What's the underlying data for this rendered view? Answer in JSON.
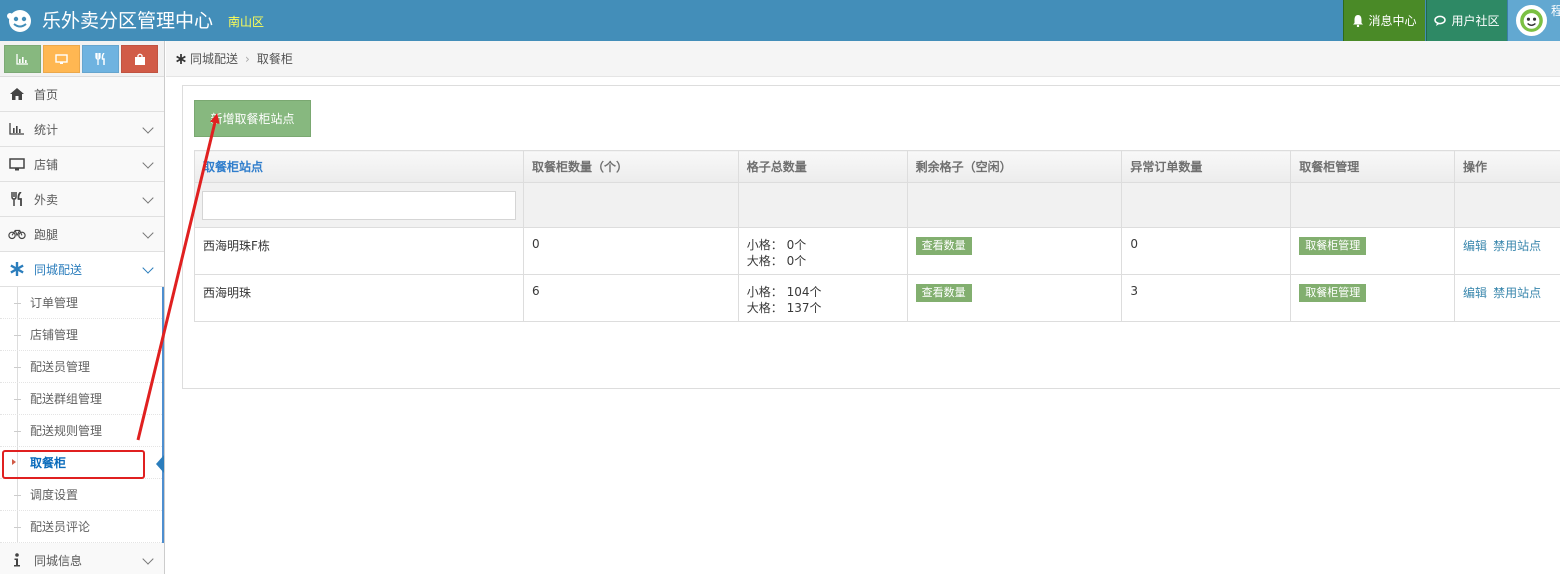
{
  "header": {
    "app_title": "乐外卖分区管理中心",
    "district": "南山区",
    "messages_label": "消息中心",
    "community_label": "用户社区",
    "user_name_partial": "程"
  },
  "colors": {
    "topbar": "#438eb9",
    "messages_bg": "#4a8a27",
    "community_bg": "#2e8965",
    "accent_green": "#87b87f",
    "link_blue": "#3a87ad",
    "annotation_red": "#e02020"
  },
  "shortcuts": [
    {
      "icon": "bar-chart-icon"
    },
    {
      "icon": "desktop-icon"
    },
    {
      "icon": "cutlery-icon"
    },
    {
      "icon": "shopping-bag-icon"
    }
  ],
  "sidebar": {
    "items": [
      {
        "label": "首页",
        "icon": "home-icon"
      },
      {
        "label": "统计",
        "icon": "bar-chart-icon"
      },
      {
        "label": "店铺",
        "icon": "desktop-icon"
      },
      {
        "label": "外卖",
        "icon": "cutlery-icon"
      },
      {
        "label": "跑腿",
        "icon": "bicycle-icon"
      },
      {
        "label": "同城配送",
        "icon": "asterisk-icon"
      },
      {
        "label": "同城信息",
        "icon": "info-icon"
      }
    ],
    "subitems": [
      {
        "label": "订单管理"
      },
      {
        "label": "店铺管理"
      },
      {
        "label": "配送员管理"
      },
      {
        "label": "配送群组管理"
      },
      {
        "label": "配送规则管理"
      },
      {
        "label": "取餐柜"
      },
      {
        "label": "调度设置"
      },
      {
        "label": "配送员评论"
      }
    ]
  },
  "breadcrumb": {
    "parent": "同城配送",
    "current": "取餐柜"
  },
  "main": {
    "add_button": "新增取餐柜站点",
    "columns": [
      "取餐柜站点",
      "取餐柜数量（个）",
      "格子总数量",
      "剩余格子（空闲）",
      "异常订单数量",
      "取餐柜管理",
      "操作"
    ],
    "rows": [
      {
        "site": "西海明珠F栋",
        "count": "0",
        "small": "小格：  0个",
        "large": "大格：  0个",
        "remaining": "查看数量",
        "abnormal": "0",
        "manage": "取餐柜管理",
        "edit": "编辑",
        "disable": "禁用站点"
      },
      {
        "site": "西海明珠",
        "count": "6",
        "small": "小格：  104个",
        "large": "大格：  137个",
        "remaining": "查看数量",
        "abnormal": "3",
        "manage": "取餐柜管理",
        "edit": "编辑",
        "disable": "禁用站点"
      }
    ]
  }
}
